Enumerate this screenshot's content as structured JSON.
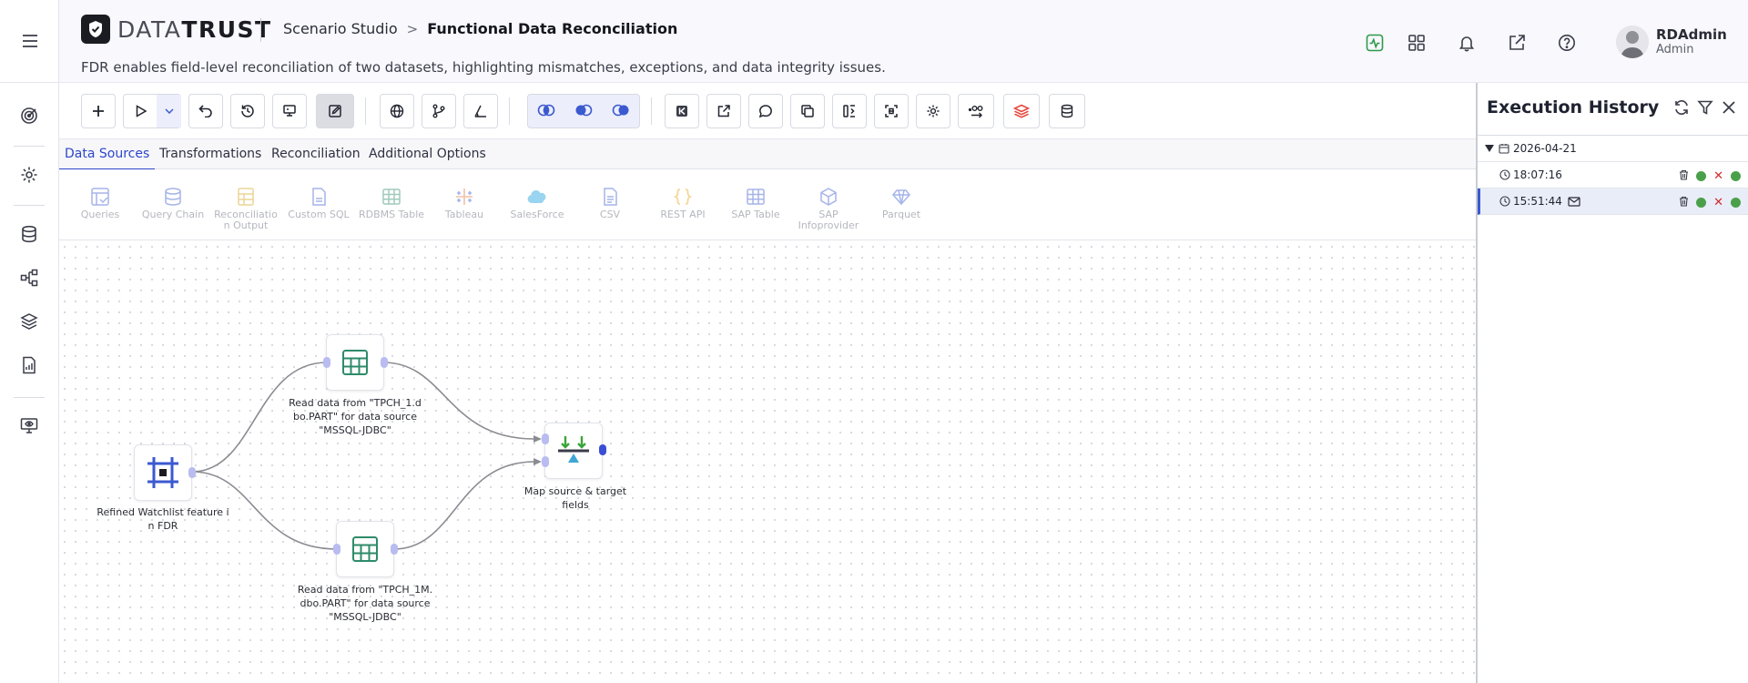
{
  "app": {
    "logo_light": "DATA",
    "logo_bold": "TRUST",
    "breadcrumb_parent": "Scenario Studio",
    "breadcrumb_sep": ">",
    "breadcrumb_current": "Functional Data Reconciliation",
    "subtitle": "FDR enables field-level reconciliation of two datasets, highlighting mismatches, exceptions, and data integrity issues."
  },
  "user": {
    "name": "RDAdmin",
    "role": "Admin"
  },
  "tabs": [
    "Data Sources",
    "Transformations",
    "Reconciliation",
    "Additional Options"
  ],
  "active_tab": "Data Sources",
  "sources": [
    "Queries",
    "Query Chain",
    "Reconciliatio n Output",
    "Custom SQL",
    "RDBMS Table",
    "Tableau",
    "SalesForce",
    "CSV",
    "REST API",
    "SAP Table",
    "SAP Infoprovider",
    "Parquet"
  ],
  "nodes": {
    "watchlist": "Refined Watchlist feature i n FDR",
    "read1": "Read data from \"TPCH_1.d bo.PART\" for data source \"MSSQL-JDBC\"",
    "read2": "Read data from \"TPCH_1M. dbo.PART\" for data source \"MSSQL-JDBC\"",
    "map": "Map source & target fields"
  },
  "history": {
    "title": "Execution History",
    "date": "2026-04-21",
    "runs": [
      {
        "time": "18:07:16",
        "mail": false,
        "selected": false
      },
      {
        "time": "15:51:44",
        "mail": true,
        "selected": true
      }
    ]
  },
  "colors": {
    "accent": "#2c46c9",
    "success": "#4aa04a",
    "error": "#d22a2a",
    "node_green": "#2e8b6a"
  }
}
